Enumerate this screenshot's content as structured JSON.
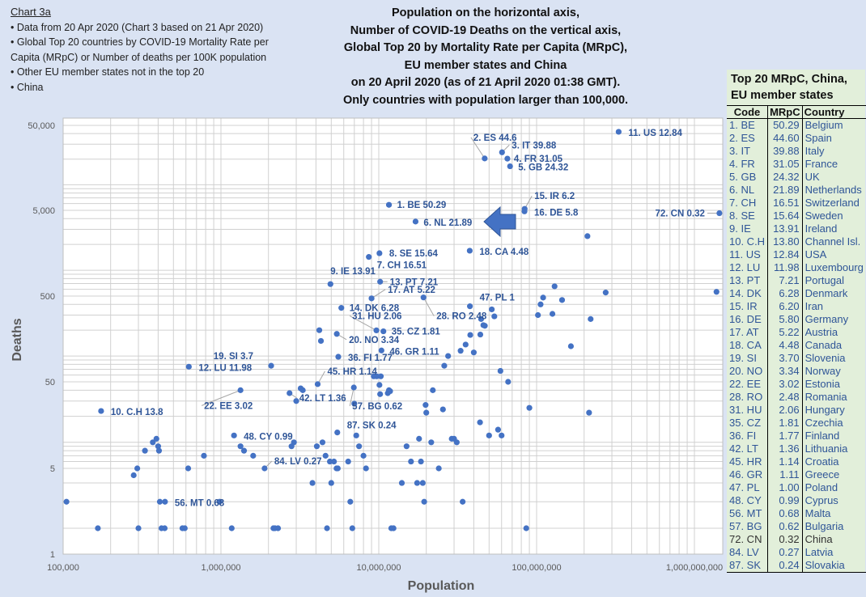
{
  "notes": {
    "heading": "Chart 3a",
    "lines": [
      "• Data from 20 Apr 2020  (Chart 3 based on 21 Apr 2020)",
      "• Global Top 20 countries by COVID-19 Mortality Rate per",
      "Capita (MRpC) or Number of deaths per 100K population",
      "• Other EU member states not in the top 20",
      "• China"
    ]
  },
  "legend": {
    "title_line1": "Top 20 MRpC, China,",
    "title_line2": "EU member states",
    "headers": [
      "Code",
      "MRpC",
      "Country"
    ],
    "rows": [
      [
        "1. BE",
        "50.29",
        "Belgium"
      ],
      [
        "2. ES",
        "44.60",
        "Spain"
      ],
      [
        "3. IT",
        "39.88",
        "Italy"
      ],
      [
        "4. FR",
        "31.05",
        "France"
      ],
      [
        "5. GB",
        "24.32",
        "UK"
      ],
      [
        "6. NL",
        "21.89",
        "Netherlands"
      ],
      [
        "7. CH",
        "16.51",
        "Switzerland"
      ],
      [
        "8. SE",
        "15.64",
        "Sweden"
      ],
      [
        "9. IE",
        "13.91",
        "Ireland"
      ],
      [
        "10. C.H",
        "13.80",
        "Channel Isl."
      ],
      [
        "11. US",
        "12.84",
        "USA"
      ],
      [
        "12. LU",
        "11.98",
        "Luxembourg"
      ],
      [
        "13. PT",
        "7.21",
        "Portugal"
      ],
      [
        "14. DK",
        "6.28",
        "Denmark"
      ],
      [
        "15. IR",
        "6.20",
        "Iran"
      ],
      [
        "16. DE",
        "5.80",
        "Germany"
      ],
      [
        "17. AT",
        "5.22",
        "Austria"
      ],
      [
        "18. CA",
        "4.48",
        "Canada"
      ],
      [
        "19. SI",
        "3.70",
        "Slovenia"
      ],
      [
        "20. NO",
        "3.34",
        "Norway"
      ],
      [
        "22. EE",
        "3.02",
        "Estonia"
      ],
      [
        "28. RO",
        "2.48",
        "Romania"
      ],
      [
        "31. HU",
        "2.06",
        "Hungary"
      ],
      [
        "35. CZ",
        "1.81",
        "Czechia"
      ],
      [
        "36. FI",
        "1.77",
        "Finland"
      ],
      [
        "42. LT",
        "1.36",
        "Lithuania"
      ],
      [
        "45. HR",
        "1.14",
        "Croatia"
      ],
      [
        "46. GR",
        "1.11",
        "Greece"
      ],
      [
        "47. PL",
        "1.00",
        "Poland"
      ],
      [
        "48. CY",
        "0.99",
        "Cyprus"
      ],
      [
        "56. MT",
        "0.68",
        "Malta"
      ],
      [
        "57. BG",
        "0.62",
        "Bulgaria"
      ],
      [
        "72. CN",
        "0.32",
        "China"
      ],
      [
        "84. LV",
        "0.27",
        "Latvia"
      ],
      [
        "87. SK",
        "0.24",
        "Slovakia"
      ]
    ]
  },
  "chart_data": {
    "type": "scatter",
    "title": [
      "Population on the horizontal axis,",
      "Number of COVID-19 Deaths on the vertical axis,",
      "Global Top 20 by Mortality Rate per Capita (MRpC),",
      "EU  member states and China",
      "on 20 April 2020 (as of 21 April 2020 01:38 GMT).",
      "Only countries with population larger than 100,000."
    ],
    "xlabel": "Population",
    "ylabel": "Deaths",
    "xscale": "log",
    "yscale": "log",
    "xlim": [
      100000,
      1500000000
    ],
    "ylim": [
      1,
      60000
    ],
    "xticks": [
      100000,
      1000000,
      10000000,
      100000000,
      1000000000
    ],
    "xtick_labels": [
      "100,000",
      "1,000,000",
      "10,000,000",
      "100,000,000",
      "1,000,000,000"
    ],
    "yticks": [
      1,
      5,
      50,
      500,
      5000,
      50000
    ],
    "ytick_labels": [
      "1",
      "5",
      "50",
      "500",
      "5,000",
      "50,000"
    ],
    "grid": true,
    "marker_color": "#4472c4",
    "labeled_points": [
      {
        "label": "1. BE 50.29",
        "x": 11600000,
        "y": 5800
      },
      {
        "label": "2. ES 44.6",
        "x": 46900000,
        "y": 20400
      },
      {
        "label": "3. IT 39.88",
        "x": 60400000,
        "y": 24100
      },
      {
        "label": "4. FR 31.05",
        "x": 65300000,
        "y": 20300
      },
      {
        "label": "5. GB 24.32",
        "x": 67900000,
        "y": 16500
      },
      {
        "label": "6. NL 21.89",
        "x": 17100000,
        "y": 3700
      },
      {
        "label": "7. CH 16.51",
        "x": 8650000,
        "y": 1430
      },
      {
        "label": "8. SE 15.64",
        "x": 10100000,
        "y": 1580
      },
      {
        "label": "9. IE 13.91",
        "x": 4940000,
        "y": 690
      },
      {
        "label": "10. C.H 13.8",
        "x": 174000,
        "y": 23
      },
      {
        "label": "11. US 12.84",
        "x": 331000000,
        "y": 42000
      },
      {
        "label": "12. LU 11.98",
        "x": 626000,
        "y": 75
      },
      {
        "label": "13. PT 7.21",
        "x": 10200000,
        "y": 735
      },
      {
        "label": "14. DK 6.28",
        "x": 5790000,
        "y": 364
      },
      {
        "label": "15. IR 6.2",
        "x": 84000000,
        "y": 5200
      },
      {
        "label": "16. DE 5.8",
        "x": 83800000,
        "y": 4860
      },
      {
        "label": "17. AT 5.22",
        "x": 9000000,
        "y": 470
      },
      {
        "label": "18. CA 4.48",
        "x": 37700000,
        "y": 1690
      },
      {
        "label": "19. SI 3.7",
        "x": 2080000,
        "y": 77
      },
      {
        "label": "20. NO 3.34",
        "x": 5420000,
        "y": 181
      },
      {
        "label": "22. EE 3.02",
        "x": 1330000,
        "y": 40
      },
      {
        "label": "28. RO 2.48",
        "x": 19200000,
        "y": 482
      },
      {
        "label": "31. HU 2.06",
        "x": 9660000,
        "y": 199
      },
      {
        "label": "35. CZ 1.81",
        "x": 10700000,
        "y": 194
      },
      {
        "label": "36. FI 1.77",
        "x": 5540000,
        "y": 98
      },
      {
        "label": "42. LT 1.36",
        "x": 2720000,
        "y": 37
      },
      {
        "label": "45. HR 1.14",
        "x": 4100000,
        "y": 47
      },
      {
        "label": "46. GR 1.11",
        "x": 10400000,
        "y": 116
      },
      {
        "label": "47. PL 1",
        "x": 37800000,
        "y": 380
      },
      {
        "label": "48. CY 0.99",
        "x": 1210000,
        "y": 12
      },
      {
        "label": "56. MT 0.68",
        "x": 442000,
        "y": 3
      },
      {
        "label": "57. BG 0.62",
        "x": 6950000,
        "y": 43
      },
      {
        "label": "72. CN 0.32",
        "x": 1440000000,
        "y": 4632
      },
      {
        "label": "84. LV 0.27",
        "x": 1890000,
        "y": 5
      },
      {
        "label": "87. SK 0.24",
        "x": 5460000,
        "y": 13
      }
    ],
    "other_points": [
      [
        105000,
        3
      ],
      [
        166000,
        2
      ],
      [
        280000,
        4.5
      ],
      [
        295000,
        5
      ],
      [
        300000,
        2
      ],
      [
        330000,
        8
      ],
      [
        370000,
        10
      ],
      [
        390000,
        11
      ],
      [
        400000,
        9
      ],
      [
        405000,
        8
      ],
      [
        410000,
        3
      ],
      [
        420000,
        2
      ],
      [
        440000,
        2
      ],
      [
        570000,
        2
      ],
      [
        590000,
        2
      ],
      [
        620000,
        5
      ],
      [
        780000,
        7
      ],
      [
        980000,
        3
      ],
      [
        1170000,
        2
      ],
      [
        1330000,
        9
      ],
      [
        1400000,
        8
      ],
      [
        1600000,
        7
      ],
      [
        2150000,
        2
      ],
      [
        2200000,
        2
      ],
      [
        2300000,
        2
      ],
      [
        2800000,
        9
      ],
      [
        2900000,
        10
      ],
      [
        3000000,
        30
      ],
      [
        3200000,
        42
      ],
      [
        3300000,
        40
      ],
      [
        3800000,
        4
      ],
      [
        4050000,
        9
      ],
      [
        4200000,
        200
      ],
      [
        4300000,
        150
      ],
      [
        4400000,
        10
      ],
      [
        4600000,
        7
      ],
      [
        4700000,
        2
      ],
      [
        4900000,
        6
      ],
      [
        5000000,
        4
      ],
      [
        5200000,
        6
      ],
      [
        5400000,
        5
      ],
      [
        5500000,
        5
      ],
      [
        6400000,
        6
      ],
      [
        6600000,
        3
      ],
      [
        6800000,
        2
      ],
      [
        7000000,
        28
      ],
      [
        7200000,
        12
      ],
      [
        7500000,
        9
      ],
      [
        8000000,
        7
      ],
      [
        8300000,
        5
      ],
      [
        9300000,
        58
      ],
      [
        9700000,
        58
      ],
      [
        10100000,
        46
      ],
      [
        10200000,
        36
      ],
      [
        10300000,
        58
      ],
      [
        11400000,
        37
      ],
      [
        11600000,
        40
      ],
      [
        11800000,
        39
      ],
      [
        12000000,
        2
      ],
      [
        12400000,
        2
      ],
      [
        14000000,
        4
      ],
      [
        15000000,
        9
      ],
      [
        16000000,
        6
      ],
      [
        17500000,
        4
      ],
      [
        18000000,
        11
      ],
      [
        18500000,
        6
      ],
      [
        19000000,
        4
      ],
      [
        19400000,
        3
      ],
      [
        19800000,
        27
      ],
      [
        20000000,
        22
      ],
      [
        21500000,
        10
      ],
      [
        22000000,
        40
      ],
      [
        24000000,
        5
      ],
      [
        25500000,
        24
      ],
      [
        26000000,
        77
      ],
      [
        27500000,
        100
      ],
      [
        29000000,
        11
      ],
      [
        30000000,
        11
      ],
      [
        31200000,
        10
      ],
      [
        33000000,
        115
      ],
      [
        34000000,
        3
      ],
      [
        35500000,
        136
      ],
      [
        38000000,
        176
      ],
      [
        40000000,
        110
      ],
      [
        43800000,
        17
      ],
      [
        44000000,
        178
      ],
      [
        44500000,
        270
      ],
      [
        46000000,
        229
      ],
      [
        47000000,
        225
      ],
      [
        50000000,
        12
      ],
      [
        52000000,
        350
      ],
      [
        54000000,
        290
      ],
      [
        57000000,
        14
      ],
      [
        59000000,
        67
      ],
      [
        60000000,
        12
      ],
      [
        66000000,
        50
      ],
      [
        86000000,
        2
      ],
      [
        90000000,
        25
      ],
      [
        102000000,
        300
      ],
      [
        106000000,
        400
      ],
      [
        110000000,
        480
      ],
      [
        126000000,
        310
      ],
      [
        130000000,
        650
      ],
      [
        145000000,
        450
      ],
      [
        165000000,
        130
      ],
      [
        210000000,
        2500
      ],
      [
        215000000,
        22
      ],
      [
        220000000,
        270
      ],
      [
        274000000,
        550
      ],
      [
        1380000000,
        560
      ]
    ]
  }
}
